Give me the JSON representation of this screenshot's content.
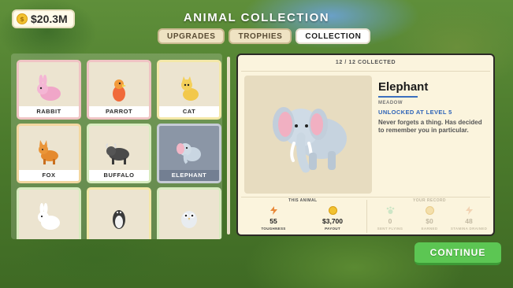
{
  "money": {
    "amount": "$20.3M",
    "icon": "coin-icon"
  },
  "header": {
    "title": "ANIMAL COLLECTION"
  },
  "tabs": [
    {
      "label": "UPGRADES",
      "active": false
    },
    {
      "label": "TROPHIES",
      "active": false
    },
    {
      "label": "COLLECTION",
      "active": true
    }
  ],
  "animals": [
    {
      "name": "RABBIT",
      "color": "#f0a6c8"
    },
    {
      "name": "PARROT",
      "color": "#f06a3a"
    },
    {
      "name": "CAT",
      "color": "#f2c84b"
    },
    {
      "name": "FOX",
      "color": "#e58a2e"
    },
    {
      "name": "BUFFALO",
      "color": "#4a4a4a"
    },
    {
      "name": "ELEPHANT",
      "color": "#b9c8d6",
      "selected": true
    },
    {
      "name": "",
      "color": "#ffffff"
    },
    {
      "name": "",
      "color": "#3a3a3a"
    },
    {
      "name": "",
      "color": "#e8ecf0"
    }
  ],
  "detail": {
    "collected": "12 / 12 COLLECTED",
    "name": "Elephant",
    "habitat": "MEADOW",
    "unlock": "UNLOCKED AT LEVEL 5",
    "description": "Never forgets a thing. Has decided to remember you in particular.",
    "this_animal_label": "THIS ANIMAL",
    "your_record_label": "YOUR RECORD",
    "stats": [
      {
        "value": "55",
        "caption": "TOUGHNESS",
        "icon": "lightning-icon"
      },
      {
        "value": "$3,700",
        "caption": "PAYOUT",
        "icon": "coin-icon"
      }
    ],
    "record": [
      {
        "value": "0",
        "caption": "SENT FLYING",
        "icon": "paw-icon"
      },
      {
        "value": "$0",
        "caption": "EARNED",
        "icon": "coin-icon"
      },
      {
        "value": "48",
        "caption": "STAMINA DRAINED",
        "icon": "lightning-icon"
      }
    ]
  },
  "continue_label": "CONTINUE",
  "colors": {
    "accent_green": "#5cc653",
    "accent_blue": "#2d63b8",
    "panel": "#fbf4dd"
  }
}
